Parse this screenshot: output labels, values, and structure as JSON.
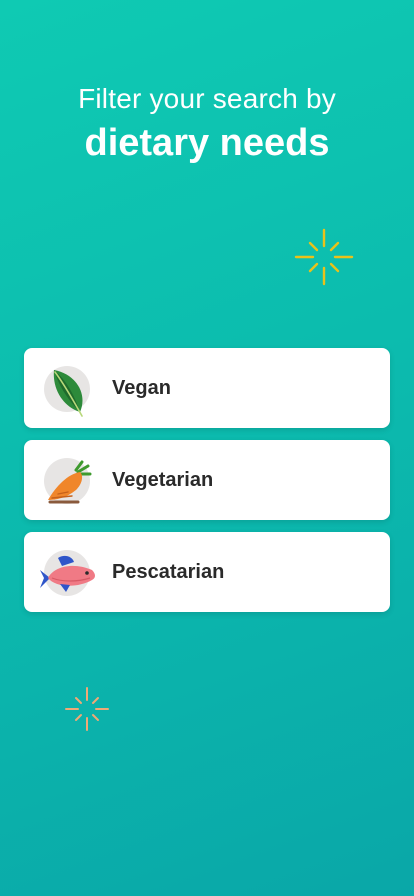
{
  "headline": {
    "line1": "Filter your search by",
    "line2": "dietary needs"
  },
  "options": [
    {
      "label": "Vegan",
      "icon": "leaf-icon"
    },
    {
      "label": "Vegetarian",
      "icon": "carrot-icon"
    },
    {
      "label": "Pescatarian",
      "icon": "fish-icon"
    }
  ],
  "colors": {
    "background_start": "#0fcab3",
    "background_end": "#0aa7a8",
    "sparkle_top": "#e9c21a",
    "sparkle_bottom": "#f0a976",
    "card_bg": "#ffffff",
    "label_text": "#2a2a2a"
  }
}
